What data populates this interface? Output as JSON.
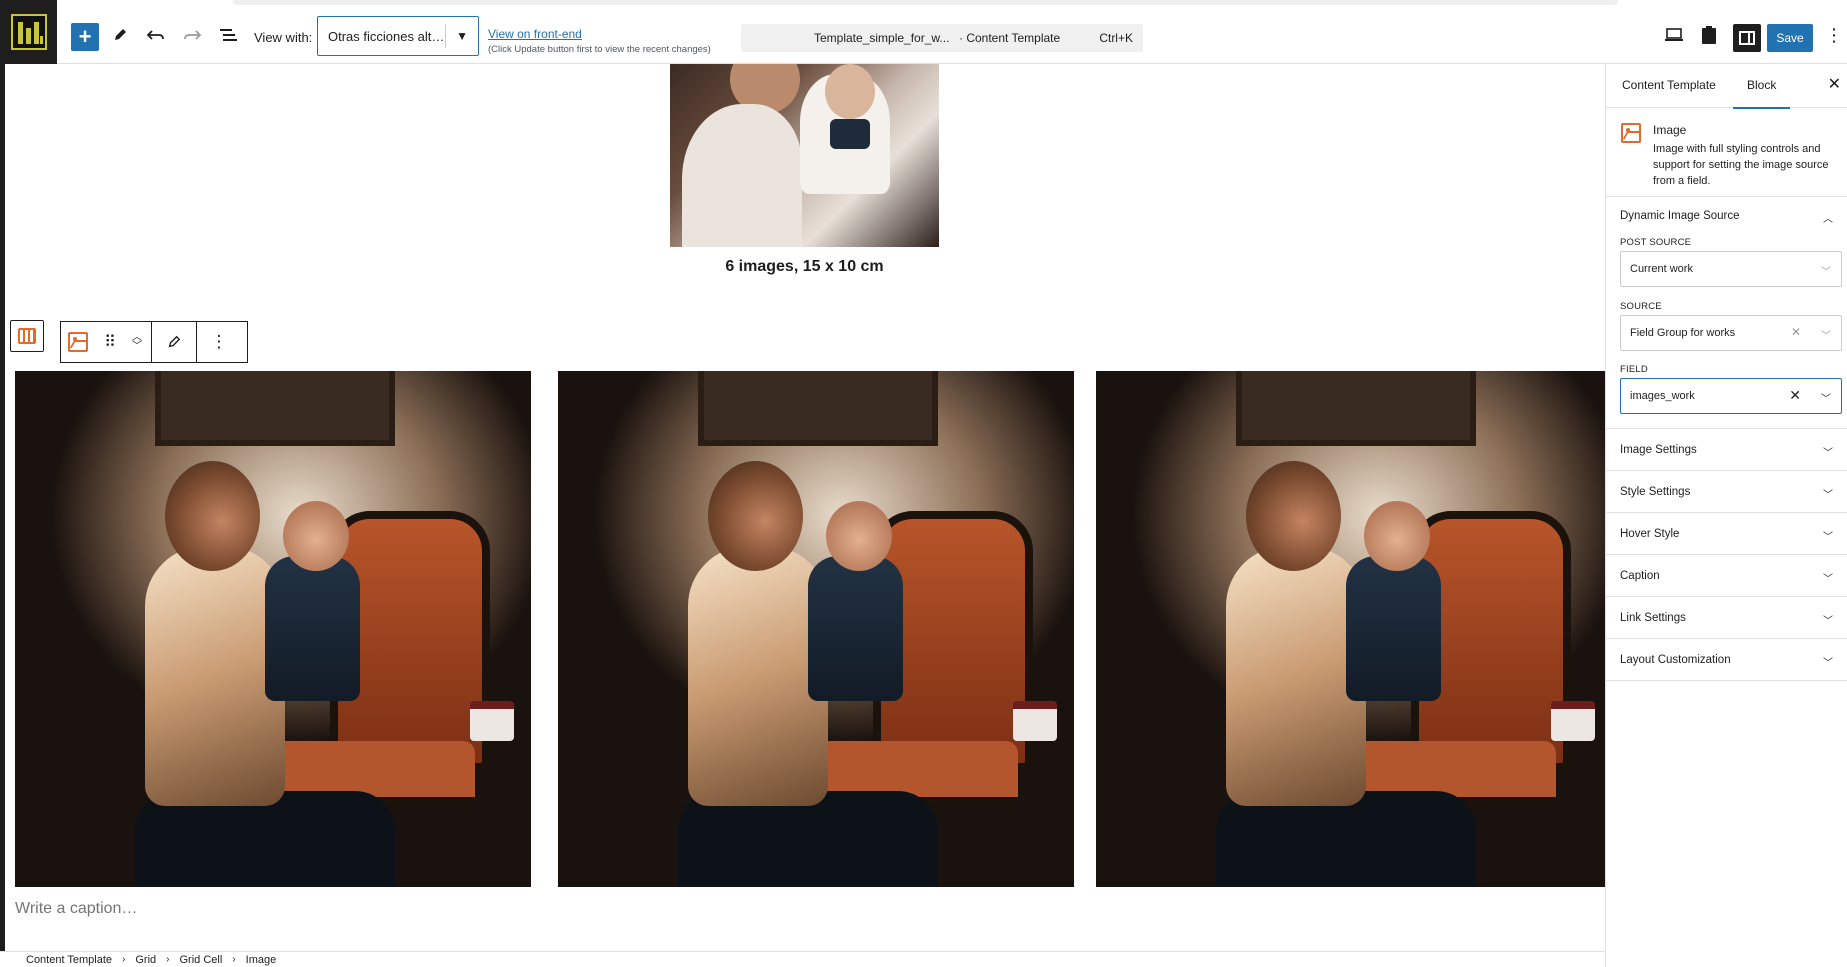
{
  "toolbar": {
    "add_icon": "plus-icon",
    "view_with_label": "View with:",
    "view_with_value": "Otras ficciones alter...",
    "frontend_link": "View on front-end",
    "frontend_note": "(Click Update button first to view the recent changes)",
    "template_name": "Template_simple_for_w...",
    "template_type": "· Content Template",
    "shortcut": "Ctrl+K",
    "save_label": "Save",
    "accent_color": "#2271b1"
  },
  "canvas": {
    "top_caption": "6 images, 15 x 10 cm",
    "caption_placeholder": "Write a caption…",
    "grid_cells": 3
  },
  "breadcrumb": [
    "Content Template",
    "Grid",
    "Grid Cell",
    "Image"
  ],
  "sidebar": {
    "tabs": [
      {
        "label": "Content Template",
        "active": false
      },
      {
        "label": "Block",
        "active": true
      }
    ],
    "block": {
      "title": "Image",
      "description": "Image with full styling controls and support for setting the image source from a field."
    },
    "dynamic_source": {
      "title": "Dynamic Image Source",
      "post_source_label": "POST SOURCE",
      "post_source_value": "Current work",
      "source_label": "SOURCE",
      "source_value": "Field Group for works",
      "field_label": "FIELD",
      "field_value": "images_work"
    },
    "panels": [
      "Image Settings",
      "Style Settings",
      "Hover Style",
      "Caption",
      "Link Settings",
      "Layout Customization"
    ]
  }
}
